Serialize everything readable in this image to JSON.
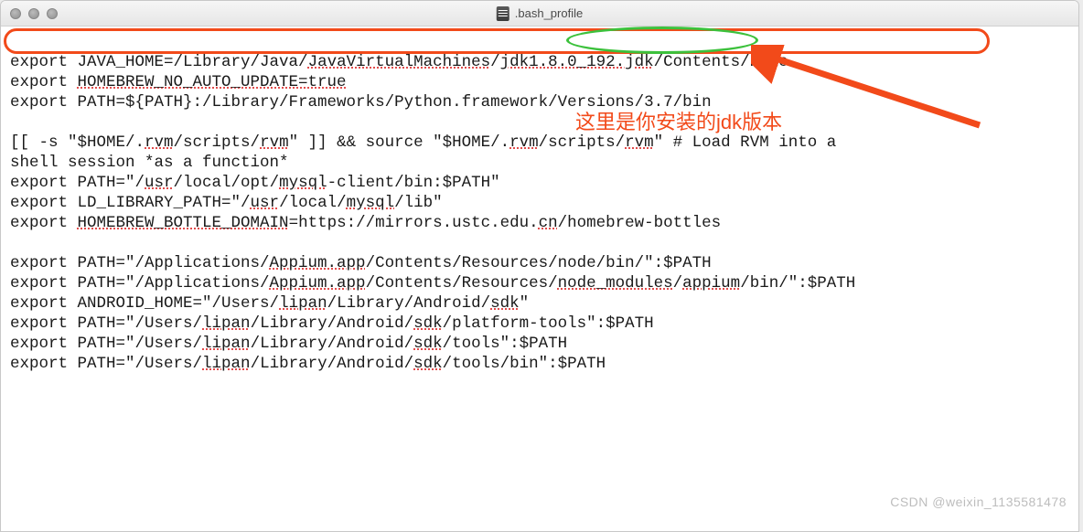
{
  "window": {
    "title": ".bash_profile"
  },
  "lines": {
    "l1a": "export JAVA_HOME=/Library/Java/",
    "l1b": "JavaVirtualMachines",
    "l1c": "/",
    "l1d": "jdk1.8.0_192.jdk",
    "l1e": "/Contents/Home",
    "l2a": "export ",
    "l2b": "HOMEBREW_NO_AUTO_UPDATE=true",
    "l3": "export PATH=${PATH}:/Library/Frameworks/Python.framework/Versions/3.7/bin",
    "l5a": "[[ -s \"$HOME/.",
    "l5b": "rvm",
    "l5c": "/scripts/",
    "l5d": "rvm",
    "l5e": "\" ]] && source \"$HOME/.",
    "l5f": "rvm",
    "l5g": "/scripts/",
    "l5h": "rvm",
    "l5i": "\" # Load RVM into a",
    "l6": "shell session *as a function*",
    "l7a": "export PATH=\"/",
    "l7b": "usr",
    "l7c": "/local/opt/",
    "l7d": "mysql",
    "l7e": "-client/bin:$PATH\"",
    "l8a": "export LD_LIBRARY_PATH=\"/",
    "l8b": "usr",
    "l8c": "/local/",
    "l8d": "mysql",
    "l8e": "/lib\"",
    "l9a": "export ",
    "l9b": "HOMEBREW_BOTTLE_DOMAIN",
    "l9c": "=https://mirrors.ustc.edu.",
    "l9d": "cn",
    "l9e": "/homebrew-bottles",
    "l11a": "export PATH=\"/Applications/",
    "l11b": "Appium.app",
    "l11c": "/Contents/Resources/node/bin/\":$PATH",
    "l12a": "export PATH=\"/Applications/",
    "l12b": "Appium.app",
    "l12c": "/Contents/Resources/",
    "l12d": "node_modules",
    "l12e": "/",
    "l12f": "appium",
    "l12g": "/bin/\":$PATH",
    "l13a": "export ANDROID_HOME=\"/Users/",
    "l13b": "lipan",
    "l13c": "/Library/Android/",
    "l13d": "sdk",
    "l13e": "\"",
    "l14a": "export PATH=\"/Users/",
    "l14b": "lipan",
    "l14c": "/Library/Android/",
    "l14d": "sdk",
    "l14e": "/platform-tools\":$PATH",
    "l15a": "export PATH=\"/Users/",
    "l15b": "lipan",
    "l15c": "/Library/Android/",
    "l15d": "sdk",
    "l15e": "/tools\":$PATH",
    "l16a": "export PATH=\"/Users/",
    "l16b": "lipan",
    "l16c": "/Library/Android/",
    "l16d": "sdk",
    "l16e": "/tools/bin\":$PATH"
  },
  "annotation": {
    "text": "这里是你安装的jdk版本"
  },
  "watermark": "CSDN @weixin_1135581478"
}
